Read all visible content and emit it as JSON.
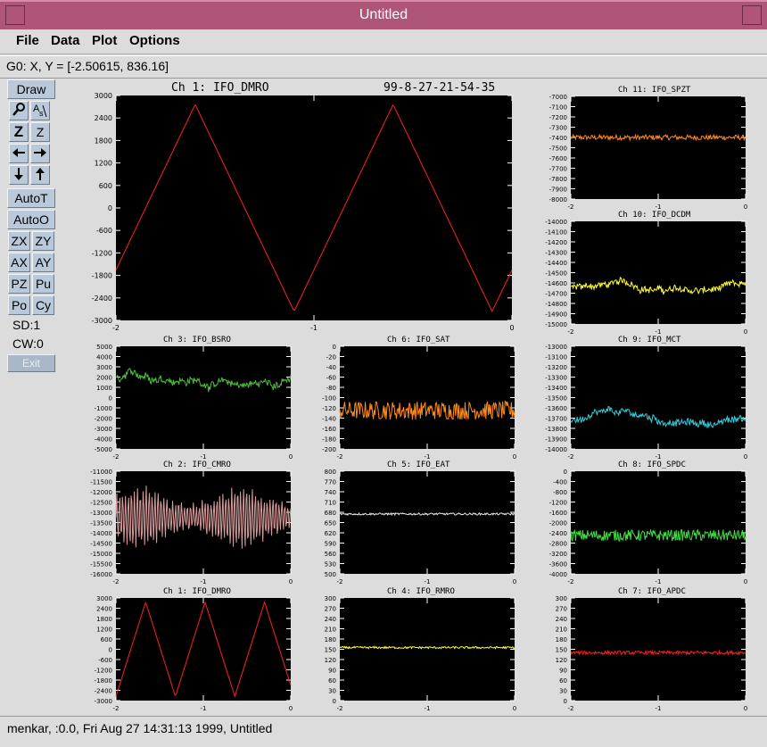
{
  "window": {
    "title": "Untitled"
  },
  "menus": [
    "File",
    "Data",
    "Plot",
    "Options"
  ],
  "coord_readout": "G0: X, Y = [-2.50615, 836.16]",
  "tools": {
    "draw": "Draw",
    "zoom_in": "Z",
    "zoom_in2": "Z",
    "autot": "AutoT",
    "autoo": "AutoO",
    "zx": "ZX",
    "zy": "ZY",
    "ax": "AX",
    "ay": "AY",
    "pz": "PZ",
    "pu": "Pu",
    "po": "Po",
    "cy": "Cy",
    "sd": "SD:1",
    "cw": "CW:0",
    "exit": "Exit"
  },
  "status": "menkar, :0.0, Fri Aug 27 14:31:13 1999, Untitled",
  "colors": {
    "titlebar": "#b0557a",
    "tool_button": "#b9c9da",
    "plot_bg": "#000000"
  },
  "chart_data": [
    {
      "type": "line",
      "title": "Ch 1:  IFO_DMRO",
      "subtitle": "99-8-27-21-54-35",
      "color": "#ff2020",
      "xlim": [
        -2,
        0
      ],
      "xticks": [
        "-2",
        "-1",
        "0"
      ],
      "ylim": [
        -3000,
        3000
      ],
      "yticks": [
        "3000",
        "2400",
        "1800",
        "1200",
        "600",
        "0",
        "-600",
        "-1200",
        "-1800",
        "-2400",
        "-3000"
      ],
      "signal": "tri",
      "period": 1.0,
      "phase": 0.1
    },
    {
      "type": "line",
      "title": "Ch 11:  IFO_SPZT",
      "color": "#ff8c1a",
      "xlim": [
        -2,
        0
      ],
      "xticks": [
        "-2",
        "-1",
        "0"
      ],
      "ylim": [
        -8000,
        -7000
      ],
      "yticks": [
        "-7000",
        "-7100",
        "-7200",
        "-7300",
        "-7400",
        "-7500",
        "-7600",
        "-7700",
        "-7800",
        "-7900",
        "-8000"
      ],
      "signal": "noise",
      "center": -7400,
      "amp": 25
    },
    {
      "type": "line",
      "title": "Ch 10:  IFO_DCDM",
      "color": "#ffff30",
      "xlim": [
        -2,
        0
      ],
      "xticks": [
        "-2",
        "-1",
        "0"
      ],
      "ylim": [
        -15000,
        -14000
      ],
      "yticks": [
        "-14000",
        "-14100",
        "-14200",
        "-14300",
        "-14400",
        "-14500",
        "-14600",
        "-14700",
        "-14800",
        "-14900",
        "-15000"
      ],
      "signal": "wander",
      "center": -14650,
      "amp": 60
    },
    {
      "type": "line",
      "title": "Ch 3:  IFO_BSRO",
      "color": "#50c040",
      "xlim": [
        -2,
        0
      ],
      "xticks": [
        "-2",
        "-1",
        "0"
      ],
      "ylim": [
        -5000,
        5000
      ],
      "yticks": [
        "5000",
        "4000",
        "3000",
        "2000",
        "1000",
        "0",
        "-1000",
        "-2000",
        "-3000",
        "-4000",
        "-5000"
      ],
      "signal": "wander",
      "center": 1700,
      "amp": 700
    },
    {
      "type": "line",
      "title": "Ch 6:  IFO_SAT",
      "color": "#ff8c1a",
      "xlim": [
        -2,
        0
      ],
      "xticks": [
        "-2",
        "-1",
        "0"
      ],
      "ylim": [
        -200,
        0
      ],
      "yticks": [
        "0",
        "-20",
        "-40",
        "-60",
        "-80",
        "-100",
        "-120",
        "-140",
        "-160",
        "-180",
        "-200"
      ],
      "signal": "noise",
      "center": -125,
      "amp": 18
    },
    {
      "type": "line",
      "title": "Ch 9:  IFO_MCT",
      "color": "#30d0e0",
      "xlim": [
        -2,
        0
      ],
      "xticks": [
        "-2",
        "-1",
        "0"
      ],
      "ylim": [
        -14000,
        -13000
      ],
      "yticks": [
        "-13000",
        "-13100",
        "-13200",
        "-13300",
        "-13400",
        "-13500",
        "-13600",
        "-13700",
        "-13800",
        "-13900",
        "-14000"
      ],
      "signal": "wander",
      "center": -13720,
      "amp": 60
    },
    {
      "type": "line",
      "title": "Ch 2:  IFO_CMRO",
      "color": "#d89c9c",
      "xlim": [
        -2,
        0
      ],
      "xticks": [
        "-2",
        "-1",
        "0"
      ],
      "ylim": [
        -16000,
        -11000
      ],
      "yticks": [
        "-11000",
        "-11500",
        "-12000",
        "-12500",
        "-13000",
        "-13500",
        "-14000",
        "-14500",
        "-15000",
        "-15500",
        "-16000"
      ],
      "signal": "osc",
      "center": -13250,
      "amp": 1400
    },
    {
      "type": "line",
      "title": "Ch 5:  IFO_EAT",
      "color": "#e8e8e8",
      "xlim": [
        -2,
        0
      ],
      "xticks": [
        "-2",
        "-1",
        "0"
      ],
      "ylim": [
        500,
        800
      ],
      "yticks": [
        "800",
        "770",
        "740",
        "710",
        "680",
        "650",
        "620",
        "590",
        "560",
        "530",
        "500"
      ],
      "signal": "noise",
      "center": 675,
      "amp": 3
    },
    {
      "type": "line",
      "title": "Ch 8:  IFO_SPDC",
      "color": "#40e040",
      "xlim": [
        -2,
        0
      ],
      "xticks": [
        "-2",
        "-1",
        "0"
      ],
      "ylim": [
        -4000,
        0
      ],
      "yticks": [
        "0",
        "-400",
        "-800",
        "-1200",
        "-1600",
        "-2000",
        "-2400",
        "-2800",
        "-3200",
        "-3600",
        "-4000"
      ],
      "signal": "noise",
      "center": -2500,
      "amp": 220
    },
    {
      "type": "line",
      "title": "Ch 1:  IFO_DMRO",
      "color": "#ff2020",
      "xlim": [
        -2,
        0
      ],
      "xticks": [
        "-2",
        "-1",
        "0"
      ],
      "ylim": [
        -3000,
        3000
      ],
      "yticks": [
        "3000",
        "2400",
        "1800",
        "1200",
        "600",
        "0",
        "-600",
        "-1200",
        "-1800",
        "-2400",
        "-3000"
      ],
      "signal": "tri",
      "period": 0.68,
      "phase": 0.0
    },
    {
      "type": "line",
      "title": "Ch 4:  IFO_RMRO",
      "color": "#ffff30",
      "xlim": [
        -2,
        0
      ],
      "xticks": [
        "-2",
        "-1",
        "0"
      ],
      "ylim": [
        0,
        300
      ],
      "yticks": [
        "300",
        "270",
        "240",
        "210",
        "180",
        "150",
        "120",
        "90",
        "60",
        "30",
        "0"
      ],
      "signal": "noise",
      "center": 155,
      "amp": 3
    },
    {
      "type": "line",
      "title": "Ch 7:  IFO_APDC",
      "color": "#ff2020",
      "xlim": [
        -2,
        0
      ],
      "xticks": [
        "-2",
        "-1",
        "0"
      ],
      "ylim": [
        0,
        300
      ],
      "yticks": [
        "300",
        "270",
        "240",
        "210",
        "180",
        "150",
        "120",
        "90",
        "60",
        "30",
        "0"
      ],
      "signal": "noise",
      "center": 140,
      "amp": 5
    }
  ]
}
